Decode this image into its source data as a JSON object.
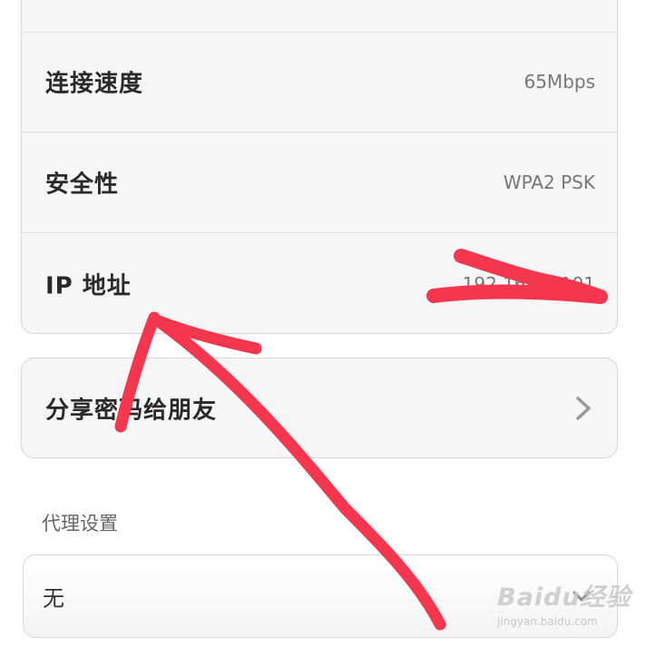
{
  "wifi_details": {
    "speed": {
      "label": "连接速度",
      "value": "65Mbps"
    },
    "security": {
      "label": "安全性",
      "value": "WPA2 PSK"
    },
    "ip": {
      "label": "IP 地址",
      "value": "192.168.1.101"
    }
  },
  "share": {
    "label": "分享密码给朋友"
  },
  "proxy": {
    "section_label": "代理设置",
    "selected": "无"
  },
  "watermark": {
    "text": "Baidu经验",
    "url": "jingyan.baidu.com"
  },
  "colors": {
    "annotation": "#f5364f",
    "card_bg": "#f6f6f6",
    "border": "#d6d6d6"
  },
  "icons": {
    "share_chevron": "chevron-right-icon",
    "proxy_dropdown": "chevron-down-icon"
  }
}
